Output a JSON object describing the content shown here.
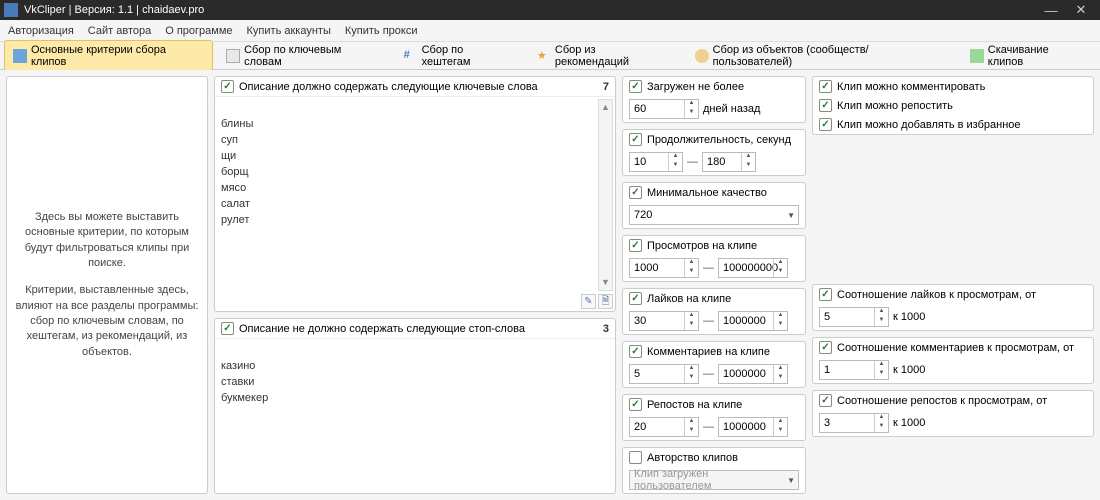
{
  "window": {
    "title": "VkCliper | Версия: 1.1 | chaidaev.pro"
  },
  "menu": {
    "auth": "Авторизация",
    "site": "Сайт автора",
    "about": "О программе",
    "buy_acc": "Купить аккаунты",
    "buy_proxy": "Купить прокси"
  },
  "toolbar": {
    "criteria": "Основные критерии сбора клипов",
    "keywords": "Сбор по ключевым словам",
    "hashtags": "Сбор по хештегам",
    "recs": "Сбор из рекомендаций",
    "objects": "Сбор из объектов (сообществ/пользователей)",
    "download": "Скачивание клипов"
  },
  "side": {
    "p1": "Здесь вы можете выставить основные критерии, по которым будут фильтроваться клипы при поиске.",
    "p2": "Критерии, выставленные здесь, влияют на все разделы программы: сбор по ключевым словам, по хештегам, из рекомендаций, из объектов."
  },
  "include": {
    "title": "Описание должно содержать следующие ключевые слова",
    "count": "7",
    "text": "блины\nсуп\nщи\nборщ\nмясо\nсалат\nрулет"
  },
  "exclude": {
    "title": "Описание не должно содержать следующие стоп-слова",
    "count": "3",
    "text": "казино\nставки\nбукмекер"
  },
  "uploaded": {
    "title": "Загружен не более",
    "value": "60",
    "suffix": "дней назад"
  },
  "duration": {
    "title": "Продолжительность, секунд",
    "from": "10",
    "to": "180"
  },
  "quality": {
    "title": "Минимальное качество",
    "value": "720"
  },
  "views": {
    "title": "Просмотров на клипе",
    "from": "1000",
    "to": "100000000"
  },
  "likes": {
    "title": "Лайков на клипе",
    "from": "30",
    "to": "1000000"
  },
  "comments": {
    "title": "Комментариев на клипе",
    "from": "5",
    "to": "1000000"
  },
  "reposts": {
    "title": "Репостов на клипе",
    "from": "20",
    "to": "1000000"
  },
  "author": {
    "title": "Авторство клипов",
    "value": "Клип загружен пользователем"
  },
  "can": {
    "comment": "Клип можно комментировать",
    "repost": "Клип можно репостить",
    "fav": "Клип можно добавлять в избранное"
  },
  "ratio": {
    "likes": {
      "title": "Соотношение лайков к просмотрам, от",
      "value": "5",
      "per": "к 1000"
    },
    "comments": {
      "title": "Соотношение комментариев к просмотрам, от",
      "value": "1",
      "per": "к 1000"
    },
    "reposts": {
      "title": "Соотношение репостов к просмотрам, от",
      "value": "3",
      "per": "к 1000"
    }
  }
}
